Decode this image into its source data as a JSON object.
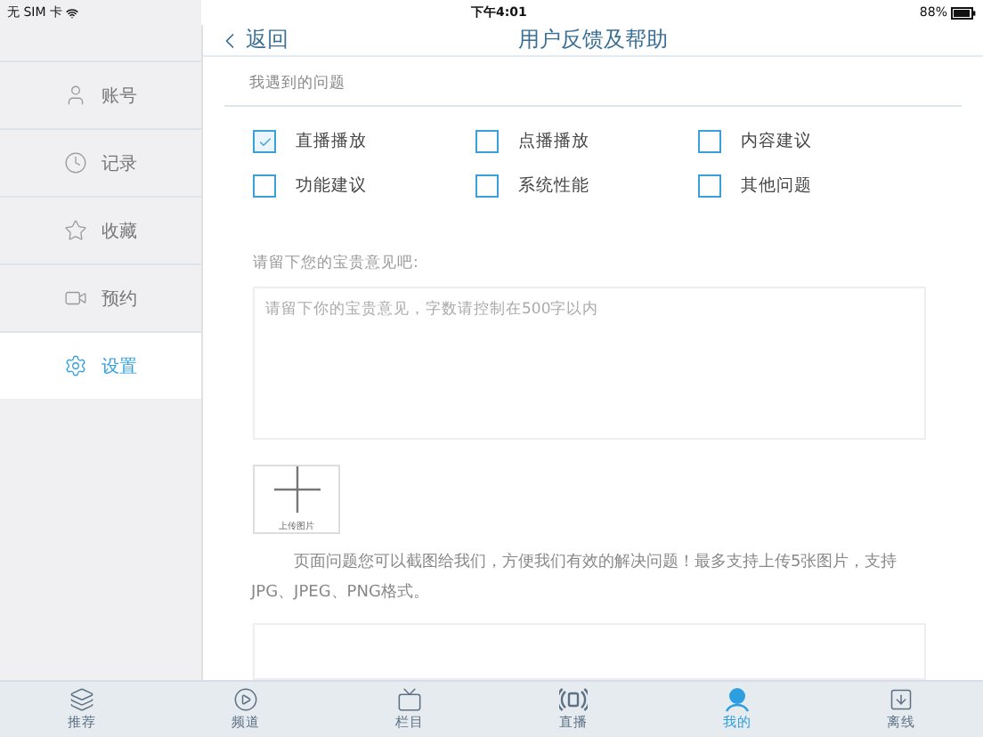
{
  "status_bar": {
    "carrier": "无 SIM 卡",
    "time": "下午4:01",
    "battery": "88%"
  },
  "nav": {
    "back": "返回",
    "title": "用户反馈及帮助"
  },
  "sidebar": {
    "items": [
      {
        "label": "账号",
        "kind": "user",
        "selected": false
      },
      {
        "label": "记录",
        "kind": "clock",
        "selected": false
      },
      {
        "label": "收藏",
        "kind": "star",
        "selected": false
      },
      {
        "label": "预约",
        "kind": "video",
        "selected": false
      },
      {
        "label": "设置",
        "kind": "gear",
        "selected": true
      }
    ]
  },
  "section_title": "我遇到的问题",
  "issues": [
    {
      "label": "直播播放",
      "checked": true
    },
    {
      "label": "点播播放",
      "checked": false
    },
    {
      "label": "内容建议",
      "checked": false
    },
    {
      "label": "功能建议",
      "checked": false
    },
    {
      "label": "系统性能",
      "checked": false
    },
    {
      "label": "其他问题",
      "checked": false
    }
  ],
  "feedback": {
    "label": "请留下您的宝贵意见吧:",
    "placeholder": "请留下你的宝贵意见，字数请控制在500字以内"
  },
  "upload": {
    "label": "上传图片"
  },
  "upload_note": "页面问题您可以截图给我们，方便我们有效的解决问题！最多支持上传5张图片，支持JPG、JPEG、PNG格式。",
  "tab_bar": [
    {
      "label": "推荐",
      "kind": "layers",
      "selected": false
    },
    {
      "label": "频道",
      "kind": "play",
      "selected": false
    },
    {
      "label": "栏目",
      "kind": "tv",
      "selected": false
    },
    {
      "label": "直播",
      "kind": "broadcast",
      "selected": false
    },
    {
      "label": "我的",
      "kind": "person",
      "selected": true
    },
    {
      "label": "离线",
      "kind": "download",
      "selected": false
    }
  ]
}
